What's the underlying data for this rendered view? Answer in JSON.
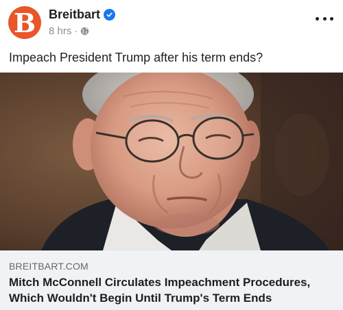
{
  "post": {
    "page_name": "Breitbart",
    "avatar_letter": "B",
    "timestamp": "8 hrs",
    "separator": "·",
    "text": "Impeach President Trump after his term ends?"
  },
  "link": {
    "domain": "BREITBART.COM",
    "title": "Mitch McConnell Circulates Impeachment Procedures, Which Wouldn't Begin Until Trump's Term Ends"
  },
  "icons": {
    "verified": "verified-badge-icon",
    "audience": "globe-icon",
    "more": "more-options-icon"
  },
  "colors": {
    "brand_avatar": "#e8562a",
    "verified_blue": "#1877f2",
    "meta_gray": "#8a8d91",
    "link_footer_bg": "#f0f2f5"
  }
}
